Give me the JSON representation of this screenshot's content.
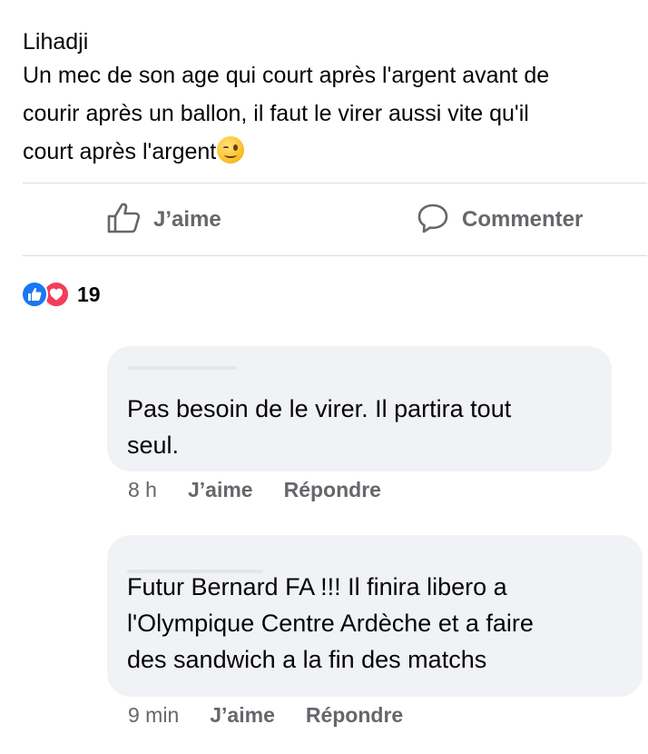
{
  "post": {
    "author": "Lihadji",
    "lines": [
      "Un mec de son age qui court après l'argent avant de",
      "courir après un  ballon, il faut le virer aussi vite qu'il",
      "court après l'argent"
    ],
    "emoji": "winking-face"
  },
  "actions": {
    "like_label": "J’aime",
    "comment_label": "Commenter"
  },
  "reactions": {
    "types": [
      "like",
      "love"
    ],
    "count": "19",
    "colors": {
      "like": "#1877f2",
      "love": "#f33e58"
    }
  },
  "comments": [
    {
      "lines": [
        "Pas besoin de le virer. Il partira tout",
        "seul."
      ],
      "time": "8 h",
      "like_label": "J’aime",
      "reply_label": "Répondre"
    },
    {
      "lines": [
        "Futur Bernard FA !!! Il finira libero  a",
        "l'Olympique Centre Ardèche et a faire",
        "des sandwich a la fin des matchs"
      ],
      "time": "9 min",
      "like_label": "J’aime",
      "reply_label": "Répondre"
    }
  ],
  "colors": {
    "text": "#050505",
    "secondary": "#65676b",
    "bubble": "#f0f2f5",
    "divider": "#dadde1"
  }
}
